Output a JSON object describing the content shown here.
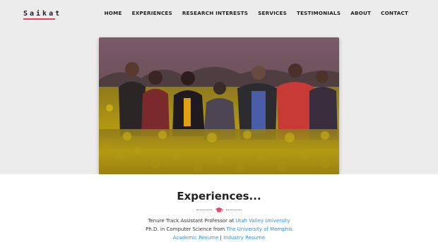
{
  "brand": {
    "name": "Saikat",
    "underline_color": "#e83e63"
  },
  "nav": {
    "items": [
      {
        "label": "HOME"
      },
      {
        "label": "EXPERIENCES"
      },
      {
        "label": "RESEARCH INTERESTS"
      },
      {
        "label": "SERVICES"
      },
      {
        "label": "TESTIMONIALS"
      },
      {
        "label": "ABOUT"
      },
      {
        "label": "CONTACT"
      }
    ]
  },
  "hero": {
    "image": "group-photo-in-mustard-field"
  },
  "experiences": {
    "title": "Experiences...",
    "icon": "graduation-cap-icon",
    "line1_text": "Tenure Track Assistant Professor at",
    "line1_link": "Utah Valley University",
    "line2_text": "Ph.D. in Computer Science from",
    "line2_link": "The University of Memphis",
    "resume_academic": "Academic Resume",
    "separator": "|",
    "resume_industry": "Industry Resume"
  },
  "colors": {
    "accent": "#e83e63",
    "link": "#2f8fd8",
    "hero_bg": "#ececec"
  }
}
